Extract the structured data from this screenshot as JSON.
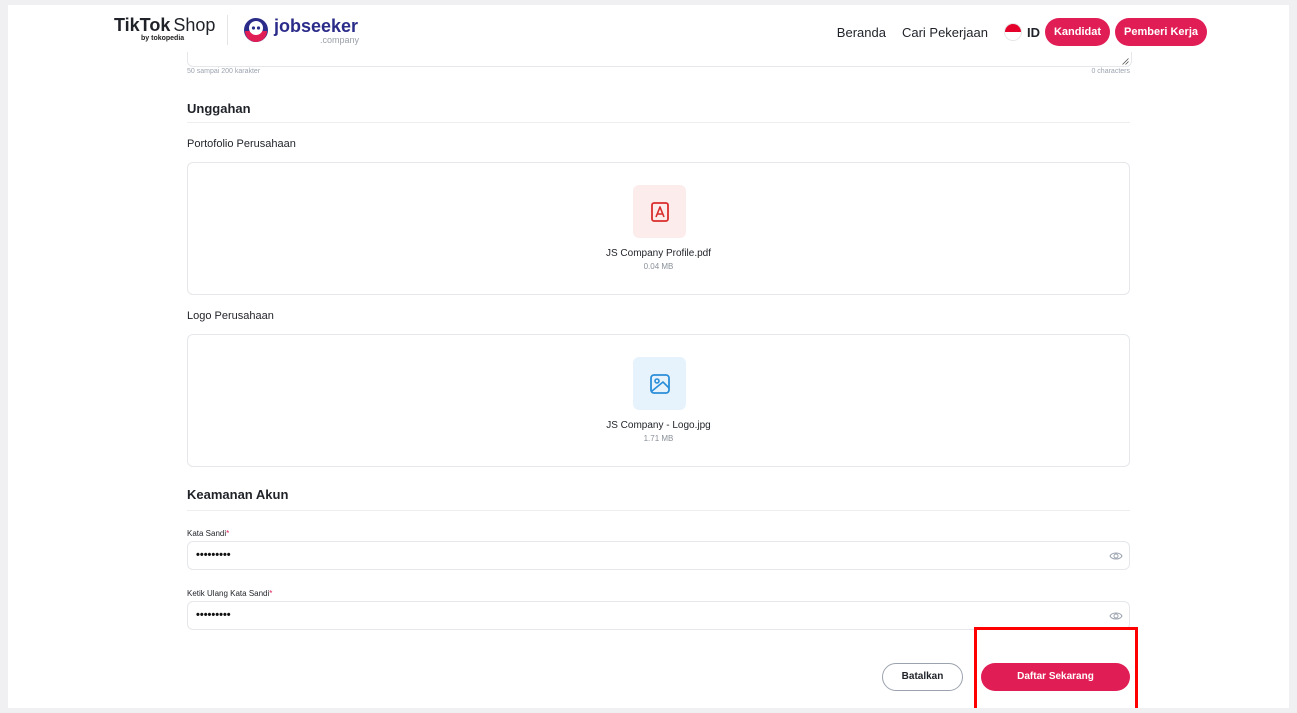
{
  "header": {
    "tiktok_brand": "TikTok",
    "tiktok_shop": "Shop",
    "tiktok_sub": "by tokopedia",
    "js_brand": "jobseeker",
    "js_sub": ".company",
    "nav": [
      "Beranda",
      "Cari Pekerjaan"
    ],
    "language": "ID",
    "candidate_button": "Kandidat",
    "employer_button": "Pemberi Kerja"
  },
  "description": {
    "hint": "50 sampai 200 karakter",
    "counter": "0 characters"
  },
  "uploads": {
    "title": "Unggahan",
    "portfolio": {
      "label": "Portofolio Perusahaan",
      "file_name": "JS Company Profile.pdf",
      "file_size": "0.04 MB"
    },
    "logo": {
      "label": "Logo Perusahaan",
      "file_name": "JS Company - Logo.jpg",
      "file_size": "1.71 MB"
    }
  },
  "security": {
    "title": "Keamanan Akun",
    "password_label": "Kata Sandi",
    "password_value": "•••••••••",
    "confirm_label": "Ketik Ulang Kata Sandi",
    "confirm_value": "•••••••••",
    "required_mark": "*"
  },
  "actions": {
    "cancel": "Batalkan",
    "submit": "Daftar Sekarang"
  },
  "colors": {
    "accent": "#e11d55",
    "highlight": "#ff0000",
    "pdf_badge_bg": "#fdecec",
    "image_badge_bg": "#e6f3fd"
  },
  "icons": {
    "pdf": "pdf-file-icon",
    "image": "image-file-icon",
    "eye": "eye-icon"
  }
}
